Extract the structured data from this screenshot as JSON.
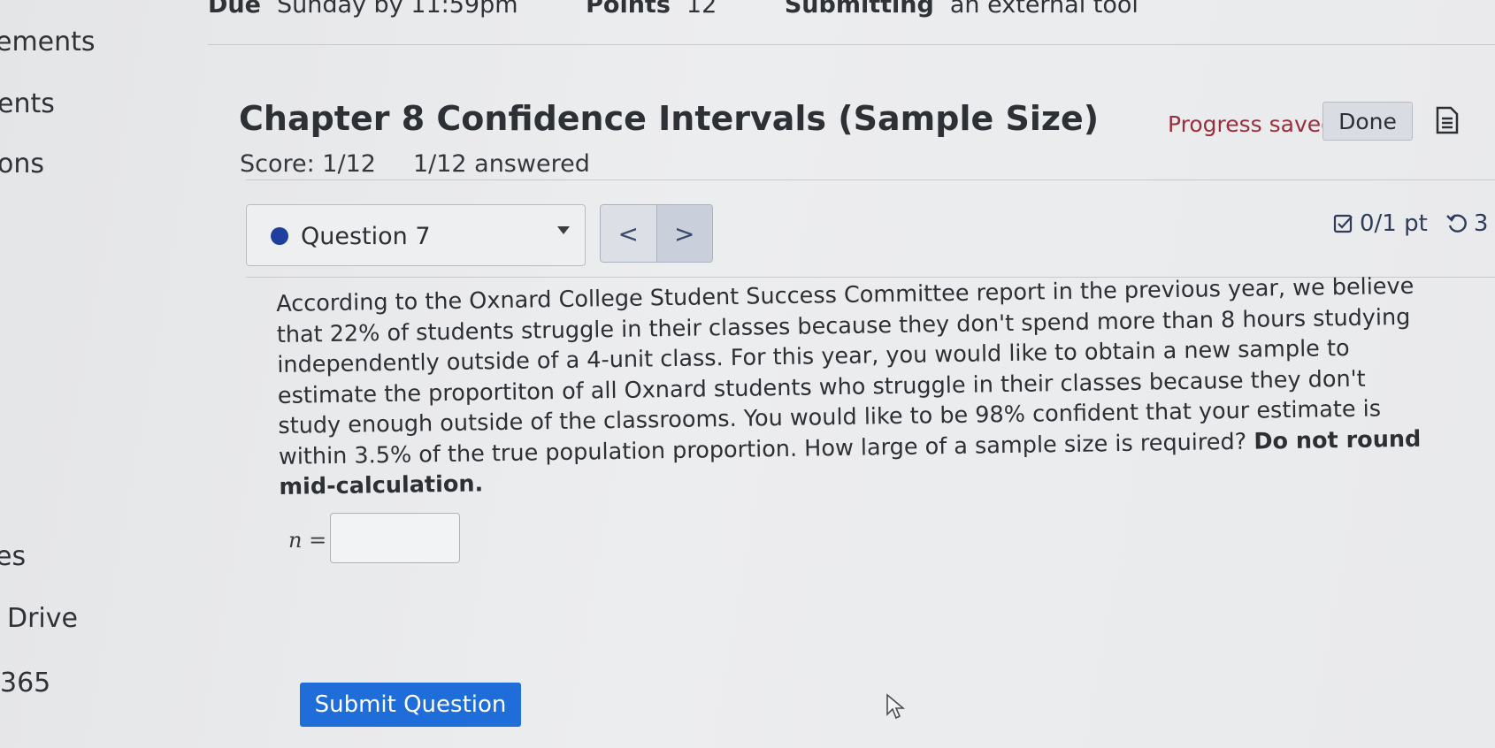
{
  "sidebar": {
    "items": [
      "ements",
      "ents",
      "ons",
      "es",
      "Drive",
      "365"
    ]
  },
  "meta": {
    "due_label": "Due",
    "due_value": "Sunday by 11:59pm",
    "points_label": "Points",
    "points_value": "12",
    "submitting_label": "Submitting",
    "submitting_value": "an external tool"
  },
  "assignment": {
    "title": "Chapter 8 Confidence Intervals (Sample Size)",
    "score": "Score: 1/12",
    "answered": "1/12 answered",
    "progress_status": "Progress saved",
    "done_label": "Done"
  },
  "question": {
    "selector_label": "Question 7",
    "prev_label": "<",
    "next_label": ">",
    "points": "0/1 pt",
    "retries": "3",
    "text": "According to the Oxnard College Student Success Committee report in the previous year, we believe that 22% of students struggle in their classes because they don't spend more than 8 hours studying independently outside of a 4-unit class. For this year, you would like to obtain a new sample to estimate the proportiton of all Oxnard students who struggle in their classes because they don't study enough outside of the classrooms. You would like to be 98% confident that your estimate is within 3.5% of the true population proportion. How large of a sample size is required?",
    "emphasis": "Do not round mid-calculation.",
    "answer_label": "n =",
    "answer_value": "",
    "submit_label": "Submit Question"
  },
  "colors": {
    "accent": "#1f6dd9",
    "progress_text": "#9c2d3c",
    "question_dot": "#1f3f9e"
  },
  "icons": [
    "document-icon",
    "checkbox-icon",
    "retry-icon",
    "dropdown-caret-icon",
    "mouse-cursor-icon"
  ]
}
